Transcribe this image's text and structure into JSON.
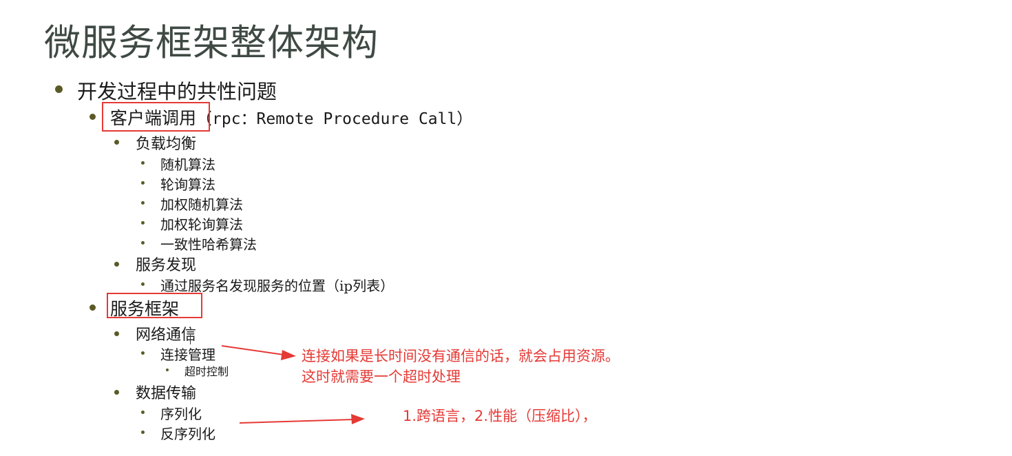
{
  "title": "微服务框架整体架构",
  "outline": {
    "l0": "开发过程中的共性问题",
    "client_call": {
      "label": "客户端调用",
      "suffix": "（rpc：Remote Procedure Call）",
      "load_balance": {
        "label": "负载均衡",
        "items": [
          "随机算法",
          "轮询算法",
          "加权随机算法",
          "加权轮询算法",
          "一致性哈希算法"
        ]
      },
      "discovery": {
        "label": "服务发现",
        "items": [
          "通过服务名发现服务的位置（ip列表）"
        ]
      }
    },
    "framework": {
      "label": "服务框架",
      "network": {
        "label": "网络通信",
        "connection": "连接管理",
        "timeout": "超时控制"
      },
      "data": {
        "label": "数据传输",
        "items": [
          "序列化",
          "反序列化"
        ]
      }
    }
  },
  "annotations": {
    "connection_note_line1": "连接如果是长时间没有通信的话，就会占用资源。",
    "connection_note_line2": "这时就需要一个超时处理",
    "serialization_note": "1.跨语言，2.性能（压缩比），"
  },
  "colors": {
    "title": "#3f4a44",
    "bullet": "#5a5a26",
    "highlight": "#e53935"
  }
}
